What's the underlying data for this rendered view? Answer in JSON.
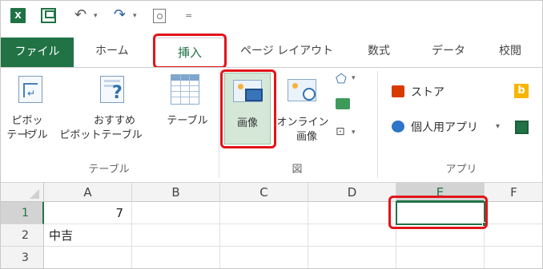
{
  "quick_access": {
    "excel_logo": "X",
    "save_icon": "save-icon",
    "undo_icon": "undo-icon",
    "redo_icon": "redo-icon",
    "preview_icon": "print-preview-icon",
    "customize_icon": "customize-icon"
  },
  "tabs": {
    "file": "ファイル",
    "home": "ホーム",
    "insert": "挿入",
    "page_layout": "ページ レイアウト",
    "formulas": "数式",
    "data": "データ",
    "review": "校閲"
  },
  "ribbon": {
    "tables": {
      "pivot_line1": "ピボット",
      "pivot_line2": "テーブル",
      "recommended_line1": "おすすめ",
      "recommended_line2": "ピボットテーブル",
      "table": "テーブル",
      "group_label": "テーブル"
    },
    "illustrations": {
      "pictures": "画像",
      "online_line1": "オンライン",
      "online_line2": "画像",
      "group_label": "図"
    },
    "apps": {
      "store": "ストア",
      "my_apps": "個人用アプリ",
      "group_label": "アプリ"
    }
  },
  "colors": {
    "excel_green": "#217346",
    "highlight_red": "#e2141a",
    "store_orange": "#d83b01",
    "bing_orange": "#f7b500"
  },
  "grid": {
    "columns": [
      "A",
      "B",
      "C",
      "D",
      "E",
      "F"
    ],
    "rows": [
      "1",
      "2",
      "3"
    ],
    "cells": {
      "A1": "7",
      "A2": "中吉"
    },
    "selected_cell": "E1"
  }
}
